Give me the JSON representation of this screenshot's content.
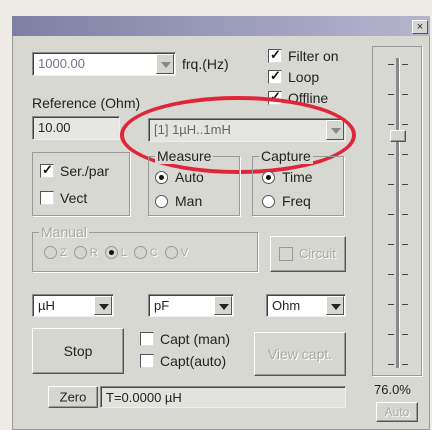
{
  "window": {
    "close_glyph": "×"
  },
  "frequency": {
    "value": "1000.00",
    "unit_label": "frq.(Hz)"
  },
  "options": {
    "filter_on": {
      "label": "Filter on",
      "checked": true
    },
    "loop": {
      "label": "Loop",
      "checked": true
    },
    "third": {
      "label": "Offline",
      "checked": true
    }
  },
  "reference": {
    "label": "Reference (Ohm)",
    "value": "10.00"
  },
  "range": {
    "value": "[1] 1µH..1mH"
  },
  "series_parallel": {
    "ser_par": {
      "label": "Ser./par",
      "checked": true
    },
    "vect": {
      "label": "Vect",
      "checked": false
    }
  },
  "measure": {
    "title": "Measure",
    "auto": "Auto",
    "man": "Man",
    "selected": "Auto"
  },
  "capture": {
    "title": "Capture",
    "time": "Time",
    "freq": "Freq",
    "selected": "Time"
  },
  "manual": {
    "title": "Manual",
    "options": [
      "Z",
      "R",
      "L",
      "C",
      "V"
    ],
    "circuit_label": "Circuit"
  },
  "units": {
    "inductance": "µH",
    "capacitance": "pF",
    "resistance": "Ohm"
  },
  "stop_button": "Stop",
  "capture_checks": {
    "manual": "Capt (man)",
    "auto": "Capt(auto)"
  },
  "view_capture_button": "View capt.",
  "zero_button": "Zero",
  "status": "T=0.0000 µH",
  "slider": {
    "percent_label": "76.0%",
    "position_fraction": 0.76
  },
  "auto_button": "Auto"
}
